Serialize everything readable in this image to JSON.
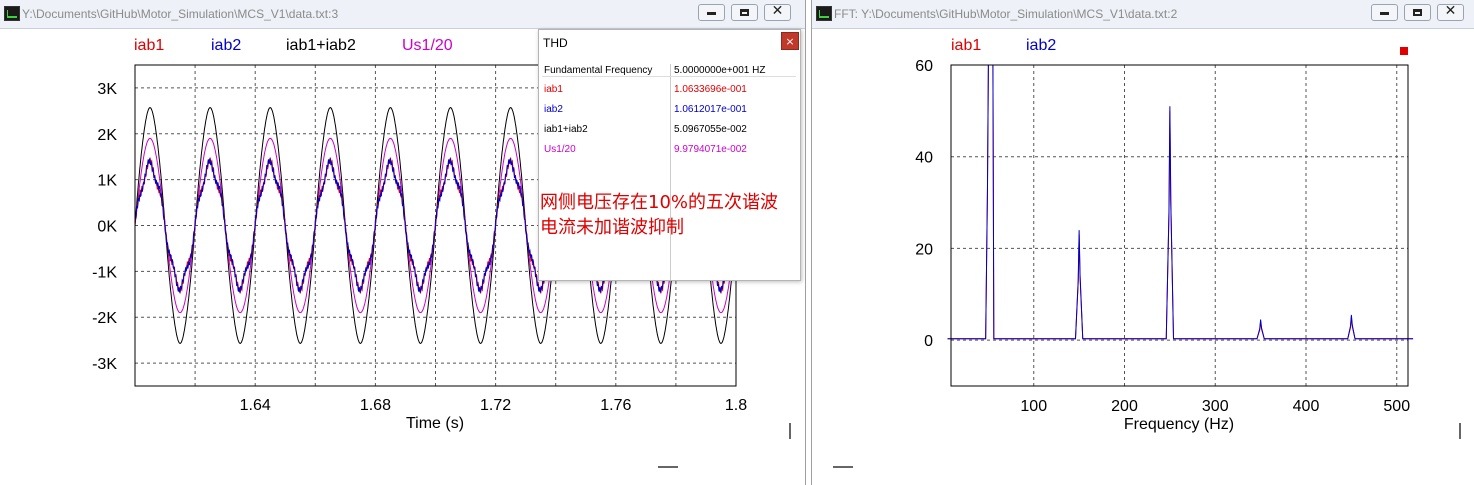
{
  "left_window": {
    "title": "Y:\\Documents\\GitHub\\Motor_Simulation\\MCS_V1\\data.txt:3",
    "legend": [
      {
        "label": "iab1",
        "color": "#e00000"
      },
      {
        "label": "iab2",
        "color": "#0000cc"
      },
      {
        "label": "iab1+iab2",
        "color": "#000000"
      },
      {
        "label": "Us1/20",
        "color": "#cc00cc"
      }
    ],
    "y_ticks": [
      "3K",
      "2K",
      "1K",
      "0K",
      "-1K",
      "-2K",
      "-3K"
    ],
    "x_ticks": [
      "1.64",
      "1.68",
      "1.72",
      "1.76",
      "1.8"
    ],
    "xlabel": "Time (s)"
  },
  "thd_dialog": {
    "title": "THD",
    "close_label": "×",
    "header_label": "Fundamental Frequency",
    "header_value": "5.0000000e+001 HZ",
    "rows": [
      {
        "label": "iab1",
        "value": "1.0633696e-001",
        "color": "#e00000"
      },
      {
        "label": "iab2",
        "value": "1.0612017e-001",
        "color": "#0000cc"
      },
      {
        "label": "iab1+iab2",
        "value": "5.0967055e-002",
        "color": "#000000"
      },
      {
        "label": "Us1/20",
        "value": "9.9794071e-002",
        "color": "#cc00cc"
      }
    ],
    "note_line1": "网侧电压存在10%的五次谐波",
    "note_line2": "电流未加谐波抑制"
  },
  "right_window": {
    "title": "FFT:  Y:\\Documents\\GitHub\\Motor_Simulation\\MCS_V1\\data.txt:2",
    "legend": [
      {
        "label": "iab1",
        "color": "#e00000"
      },
      {
        "label": "iab2",
        "color": "#0000cc"
      }
    ],
    "y_ticks": [
      "60",
      "40",
      "20",
      "0"
    ],
    "x_ticks": [
      "100",
      "200",
      "300",
      "400",
      "500"
    ],
    "xlabel": "Frequency (Hz)"
  },
  "chart_data": [
    {
      "type": "line",
      "xlabel": "Time (s)",
      "ylabel": "",
      "xlim": [
        1.6,
        1.8
      ],
      "ylim": [
        -3500,
        3500
      ],
      "frequency_hz": 50,
      "series": [
        {
          "name": "iab1",
          "color": "#e00000",
          "amplitude": 1300,
          "ripple": 120
        },
        {
          "name": "iab2",
          "color": "#0000cc",
          "amplitude": 1300,
          "ripple": 120
        },
        {
          "name": "iab1+iab2",
          "color": "#000000",
          "amplitude": 2550,
          "ripple": 40
        },
        {
          "name": "Us1/20",
          "color": "#cc00cc",
          "amplitude": 1900,
          "ripple": 0
        }
      ],
      "grid": true
    },
    {
      "type": "line",
      "xlabel": "Frequency (Hz)",
      "ylabel": "",
      "xlim": [
        0,
        520
      ],
      "ylim": [
        -10,
        60
      ],
      "series": [
        {
          "name": "iab1",
          "color": "#e00000",
          "peaks": [
            {
              "x": 50,
              "y": 60
            },
            {
              "x": 150,
              "y": 23
            },
            {
              "x": 250,
              "y": 50
            },
            {
              "x": 350,
              "y": 4
            },
            {
              "x": 450,
              "y": 5
            }
          ]
        },
        {
          "name": "iab2",
          "color": "#0000cc",
          "peaks": [
            {
              "x": 50,
              "y": 60
            },
            {
              "x": 150,
              "y": 24
            },
            {
              "x": 250,
              "y": 51
            },
            {
              "x": 350,
              "y": 4.5
            },
            {
              "x": 450,
              "y": 5.5
            }
          ]
        }
      ],
      "grid": true
    }
  ]
}
